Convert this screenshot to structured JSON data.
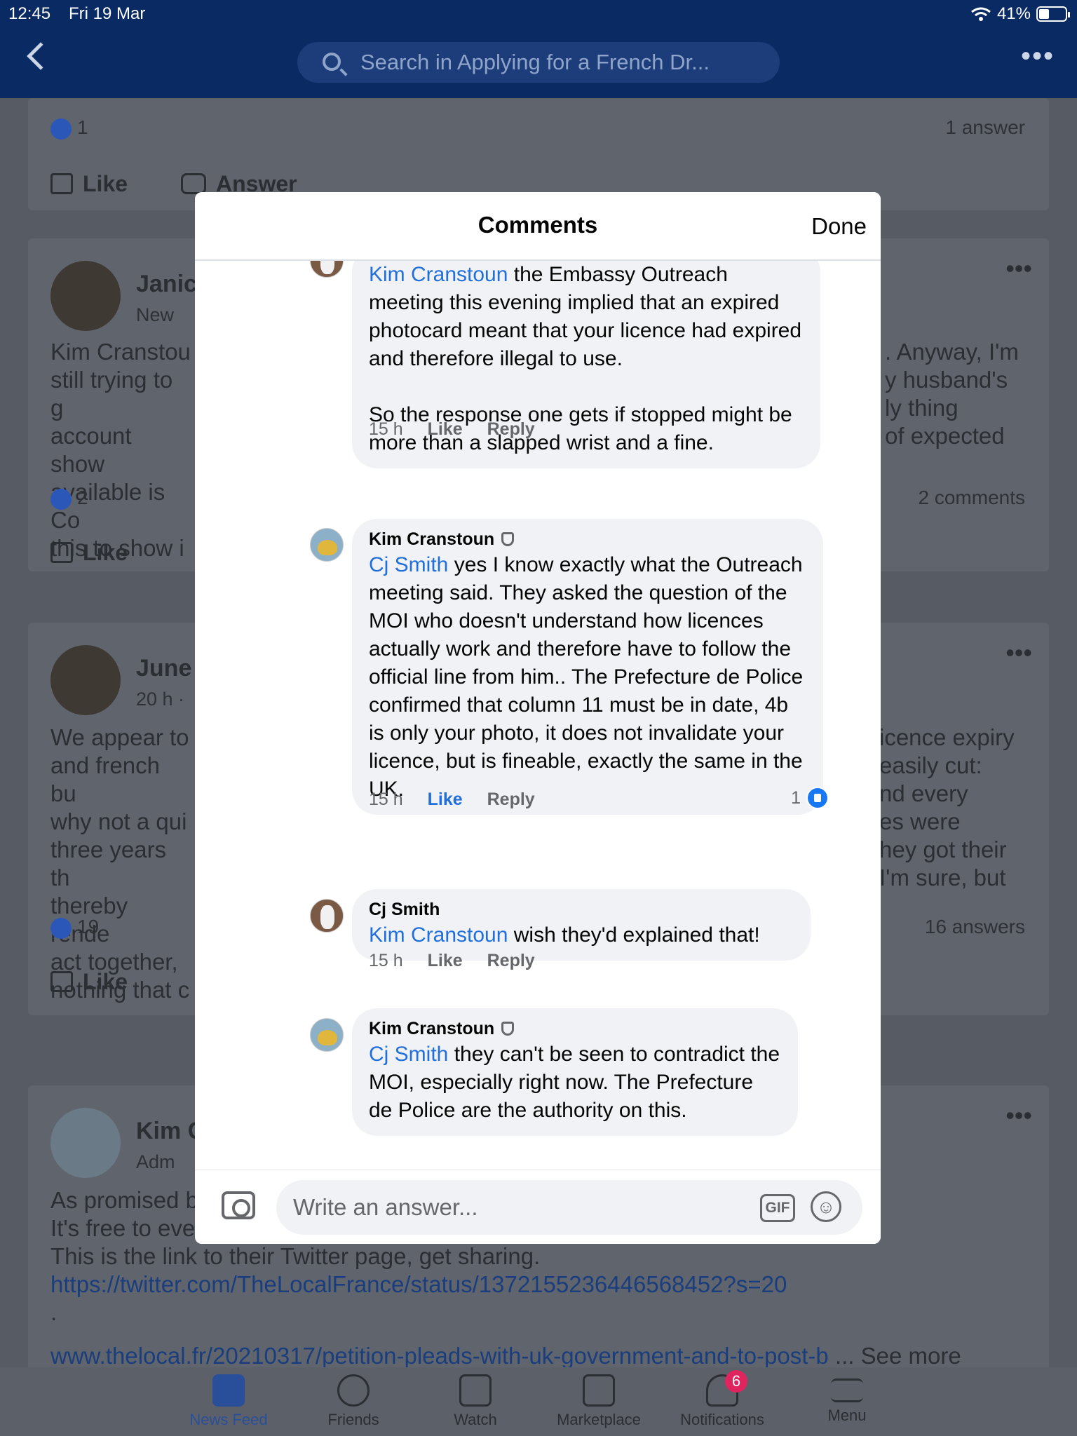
{
  "status": {
    "time": "12:45",
    "date": "Fri 19 Mar",
    "battery": "41%"
  },
  "header": {
    "search_placeholder": "Search in Applying for a French Dr..."
  },
  "feed": {
    "card1": {
      "like_count": "1",
      "answer_count": "1 answer",
      "like_label": "Like",
      "answer_label": "Answer"
    },
    "card2": {
      "name": "Janic",
      "sub": "New",
      "text_left": [
        "Kim Cranstou",
        "still trying to g",
        "account show",
        "available is Co",
        "this to show i"
      ],
      "text_right": [
        ". Anyway, I'm",
        "y husband's",
        "ly thing",
        "of expected"
      ],
      "like_count": "2",
      "comment_count": "2 comments",
      "like_label": "Like"
    },
    "card3": {
      "name": "June",
      "sub": "20 h ·",
      "text_left": [
        "We appear to",
        "and french bu",
        "why not a qui",
        "three years th",
        "thereby rende",
        "act together,",
        "nothing that c"
      ],
      "text_right": [
        "icence expiry",
        "easily cut:",
        "nd every",
        "es were",
        "hey got their",
        "I'm sure, but"
      ],
      "like_count": "19",
      "answer_count": "16 answers",
      "like_label": "Like"
    },
    "card4": {
      "name": "Kim C",
      "sub": "Adm",
      "text_lines": [
        "As promised b",
        "It's free to eve",
        "This is the link to their Twitter page, get sharing."
      ],
      "link": "https://twitter.com/TheLocalFrance/status/1372155236446568452?s=20",
      "dot": ".",
      "link2": "www.thelocal.fr/20210317/petition-pleads-with-uk-government-and-to-post-b",
      "see_more": "... See more"
    }
  },
  "modal": {
    "title": "Comments",
    "done_label": "Done",
    "comments": [
      {
        "author": "",
        "mention": "Kim Cranstoun",
        "text": " the Embassy Outreach meeting this evening implied that an expired photocard meant that your licence had expired and therefore illegal to use.",
        "text2": "So the response one gets if stopped might be more than a slapped wrist and a fine.",
        "time": "15 h",
        "like": "Like",
        "reply": "Reply"
      },
      {
        "author": "Kim Cranstoun",
        "mention": "Cj Smith",
        "text": " yes I know exactly what the Outreach meeting said.  They asked the question of the MOI who doesn't understand how licences actually work and therefore have to follow the official line from him..  The Prefecture de Police confirmed that column 11 must be in date, 4b is only your photo, it does not invalidate your licence, but is fineable, exactly the same in the UK.",
        "time": "15 h",
        "like": "Like",
        "reply": "Reply",
        "reactions": "1"
      },
      {
        "author": "Cj Smith",
        "mention": "Kim Cranstoun",
        "text": " wish they'd explained that!",
        "time": "15 h",
        "like": "Like",
        "reply": "Reply"
      },
      {
        "author": "Kim Cranstoun",
        "mention": "Cj Smith",
        "text": " they can't be seen to contradict the MOI, especially right now.  The Prefecture de Police are the authority on this."
      }
    ],
    "composer": {
      "placeholder": "Write an answer...",
      "gif_label": "GIF",
      "emoji_glyph": "☺"
    }
  },
  "tabbar": {
    "tabs": [
      "News Feed",
      "Friends",
      "Watch",
      "Marketplace",
      "Notifications",
      "Menu"
    ],
    "notifications_badge": "6"
  },
  "colors": {
    "facebook_blue": "#1877f2",
    "mention_blue": "#216fdb",
    "header_navy": "#0a2a63"
  }
}
